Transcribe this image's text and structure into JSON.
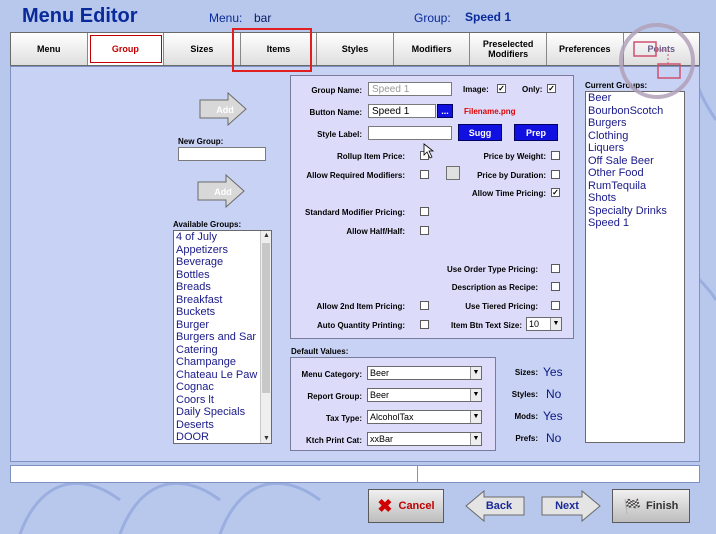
{
  "app": {
    "title": "Menu Editor"
  },
  "header": {
    "menu_label": "Menu:",
    "menu_value": "bar",
    "group_label": "Group:",
    "group_value": "Speed 1"
  },
  "tabs": [
    {
      "label": "Menu"
    },
    {
      "label": "Group"
    },
    {
      "label": "Sizes"
    },
    {
      "label": "Items"
    },
    {
      "label": "Styles"
    },
    {
      "label": "Modifiers"
    },
    {
      "label": "Preselected\nModifiers"
    },
    {
      "label": "Preferences"
    },
    {
      "label": "Points"
    }
  ],
  "left": {
    "add_label": "Add",
    "new_group_label": "New Group:",
    "new_group_value": "",
    "available_groups_label": "Available Groups:",
    "available_groups": [
      "4 of July",
      "Appetizers",
      "Beverage",
      "Bottles",
      "Breads",
      "Breakfast",
      "Buckets",
      "Burger",
      "Burgers and Sar",
      "Catering",
      "Champange",
      "Chateau Le Paw",
      "Cognac",
      "Coors lt",
      "Daily Specials",
      "Deserts",
      "DOOR"
    ]
  },
  "form": {
    "group_name_label": "Group Name:",
    "group_name_placeholder": "Speed 1",
    "image_label": "Image:",
    "image_checked": "✓",
    "only_label": "Only:",
    "only_checked": "✓",
    "button_name_label": "Button Name:",
    "button_name_value": "Speed 1",
    "ellipsis": "...",
    "filename": "Filename.png",
    "style_label": "Style Label:",
    "style_value": "",
    "sugg": "Sugg",
    "prep": "Prep",
    "rollup": "Rollup Item Price:",
    "allow_required_mods": "Allow Required Modifiers:",
    "price_by_weight": "Price by Weight:",
    "price_by_duration": "Price by Duration:",
    "allow_time_pricing": "Allow Time Pricing:",
    "allow_time_checked": "✓",
    "standard_mod_pricing": "Standard Modifier Pricing:",
    "allow_half": "Allow Half/Half:",
    "use_order_type": "Use Order Type Pricing:",
    "desc_as_recipe": "Description as Recipe:",
    "allow_2nd_item": "Allow 2nd Item Pricing:",
    "use_tiered": "Use Tiered Pricing:",
    "auto_qty": "Auto Quantity Printing:",
    "item_btn_text_size_label": "Item Btn Text Size:",
    "item_btn_text_size_value": "10"
  },
  "defaults": {
    "title": "Default Values:",
    "menu_category_label": "Menu Category:",
    "menu_category_value": "Beer",
    "report_group_label": "Report Group:",
    "report_group_value": "Beer",
    "tax_type_label": "Tax Type:",
    "tax_type_value": "AlcoholTax",
    "ktch_print_label": "Ktch Print Cat:",
    "ktch_print_value": "xxBar"
  },
  "summary": {
    "sizes_label": "Sizes:",
    "sizes_value": "Yes",
    "styles_label": "Styles:",
    "styles_value": "No",
    "mods_label": "Mods:",
    "mods_value": "Yes",
    "prefs_label": "Prefs:",
    "prefs_value": "No"
  },
  "current": {
    "label": "Current Groups:",
    "items": [
      "Beer",
      "BourbonScotch",
      "Burgers",
      "Clothing",
      "Liquers",
      "Off Sale Beer",
      "Other Food",
      "RumTequila",
      "Shots",
      "Specialty Drinks",
      "Speed 1"
    ]
  },
  "buttons": {
    "cancel": "Cancel",
    "back": "Back",
    "next": "Next",
    "finish": "Finish"
  },
  "colors": {
    "title_blue": "#0a2a9a",
    "panel_bg": "#c8d2f4",
    "accent_red": "#e02020",
    "action_blue": "#1010e0"
  }
}
